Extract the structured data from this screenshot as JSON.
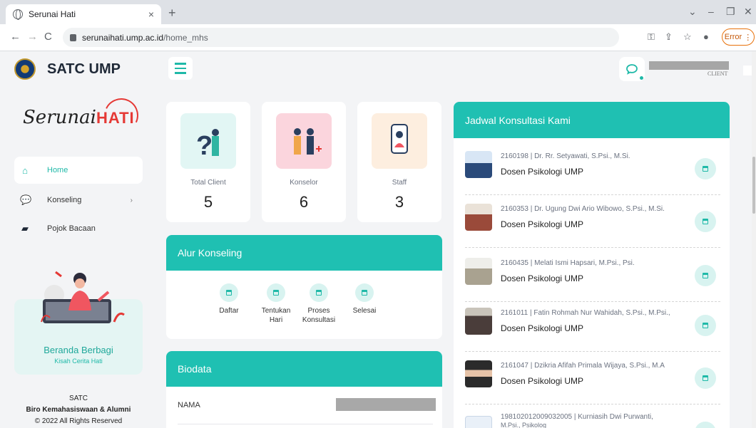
{
  "browser": {
    "tab_title": "Serunai Hati",
    "tab_close": "×",
    "new_tab": "+",
    "url_host": "serunaihati.ump.ac.id",
    "url_path": "/home_mhs",
    "error_label": "Error",
    "window_controls": [
      "⌄",
      "–",
      "❐",
      "✕"
    ]
  },
  "header": {
    "brand": "SATC UMP",
    "user_role": "CLIENT"
  },
  "sidebar": {
    "logo_text": "Serunai",
    "logo_accent": "HATI",
    "items": [
      {
        "label": "Home",
        "icon": "home-icon",
        "active": true
      },
      {
        "label": "Konseling",
        "icon": "chat-icon",
        "chevron": "›"
      },
      {
        "label": "Pojok Bacaan",
        "icon": "book-icon"
      }
    ],
    "promo_title": "Beranda Berbagi",
    "promo_subtitle": "Kisah Cerita Hati",
    "footer_line1": "SATC",
    "footer_line2": "Biro Kemahasiswaan & Alumni",
    "footer_line3": "© 2022 All Rights Reserved"
  },
  "stats": [
    {
      "label": "Total Client",
      "value": "5",
      "color": "#e2f6f4"
    },
    {
      "label": "Konselor",
      "value": "6",
      "color": "#fbd5dd"
    },
    {
      "label": "Staff",
      "value": "3",
      "color": "#fdeedf"
    }
  ],
  "alur": {
    "title": "Alur Konseling",
    "steps": [
      "Daftar",
      "Tentukan Hari",
      "Proses Konsultasi",
      "Selesai"
    ]
  },
  "biodata": {
    "title": "Biodata",
    "rows": [
      {
        "label": "NAMA"
      }
    ]
  },
  "jadwal": {
    "title": "Jadwal Konsultasi Kami",
    "items": [
      {
        "name": "2160198 | Dr. Rr. Setyawati, S.Psi., M.Si.",
        "role": "Dosen Psikologi UMP"
      },
      {
        "name": "2160353 | Dr. Ugung Dwi Ario Wibowo, S.Psi., M.Si.",
        "role": "Dosen Psikologi UMP"
      },
      {
        "name": "2160435 | Melati Ismi Hapsari, M.Psi., Psi.",
        "role": "Dosen Psikologi UMP"
      },
      {
        "name": "2161011 | Fatin Rohmah Nur Wahidah, S.Psi., M.Psi.,",
        "role": "Dosen Psikologi UMP"
      },
      {
        "name": "2161047 | Dzikria Afifah Primala Wijaya, S.Psi., M.A",
        "role": "Dosen Psikologi UMP"
      },
      {
        "name": "198102012009032005 | Kurniasih Dwi Purwanti,",
        "role": "M.Psi., Psikolog"
      }
    ]
  },
  "colors": {
    "accent": "#1fc0b2",
    "brand_red": "#e53935"
  }
}
